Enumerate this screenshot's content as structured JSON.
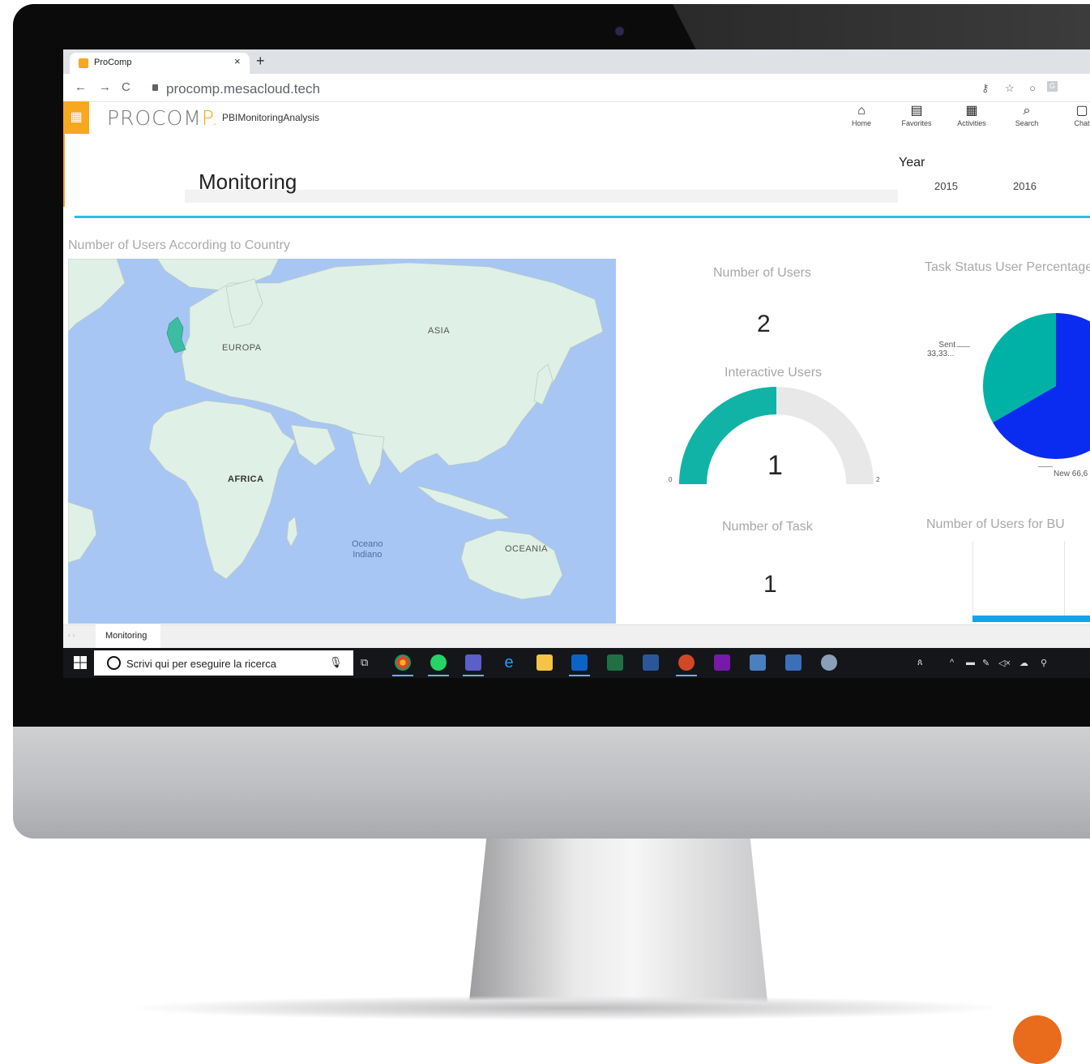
{
  "browser": {
    "tab_title": "ProComp",
    "new_tab": "+",
    "tab_close": "×",
    "url": "procomp.mesacloud.tech",
    "nav": {
      "back": "←",
      "forward": "→",
      "reload": "C"
    },
    "right_icons": [
      "key-icon",
      "star-icon",
      "extension-icon",
      "extension-icon-2"
    ]
  },
  "app": {
    "logo_main": "PROCOM",
    "logo_end": "P.",
    "title": "PBIMonitoringAnalysis",
    "nav": [
      {
        "label": "Home",
        "icon": "home-icon",
        "glyph": "⌂"
      },
      {
        "label": "Favorites",
        "icon": "favorites-icon",
        "glyph": "▤"
      },
      {
        "label": "Activities",
        "icon": "activities-icon",
        "glyph": "▦"
      },
      {
        "label": "Search",
        "icon": "search-icon",
        "glyph": "⌕"
      },
      {
        "label": "Chat",
        "icon": "chat-icon",
        "glyph": "▢"
      }
    ]
  },
  "report": {
    "title": "Monitoring",
    "year_label": "Year",
    "years": [
      "2015",
      "2016"
    ],
    "map_title": "Number of Users According to Country",
    "map_labels": {
      "europe": "EUROPA",
      "asia": "ASIA",
      "africa": "AFRICA",
      "oceania": "OCEANIA",
      "ocean": "Oceano\nIndiano"
    },
    "kpis": {
      "users_title": "Number of Users",
      "users_value": "2",
      "interactive_title": "Interactive Users",
      "interactive_value": "1",
      "interactive_min": "0",
      "interactive_max": "2",
      "tasks_title": "Number of Task",
      "tasks_value": "1"
    },
    "pie_title": "Task Status User Percentage",
    "pie_labels": {
      "sent": "Sent",
      "sent_pct": "33,33...",
      "new": "New 66,6"
    },
    "bu_title": "Number of Users for BU",
    "page_tab": "Monitoring"
  },
  "chart_data": {
    "type": "pie",
    "title": "Task Status User Percentage",
    "slices": [
      {
        "label": "New",
        "value": 66.67,
        "color": "#0a2cf0"
      },
      {
        "label": "Sent",
        "value": 33.33,
        "color": "#00b2a5"
      }
    ]
  },
  "gauge": {
    "value": 1,
    "min": 0,
    "max": 2,
    "fill": "#11b3a6",
    "track": "#e8e8e8"
  },
  "taskbar": {
    "search_placeholder": "Scrivi qui per eseguire la ricerca",
    "apps": [
      "chrome-icon",
      "whatsapp-icon",
      "teams-icon",
      "edge-icon",
      "file-explorer-icon",
      "outlook-icon",
      "excel-icon",
      "word-icon",
      "powerpoint-icon",
      "onenote-icon",
      "app-icon-1",
      "app-icon-2",
      "app-icon-3"
    ]
  }
}
